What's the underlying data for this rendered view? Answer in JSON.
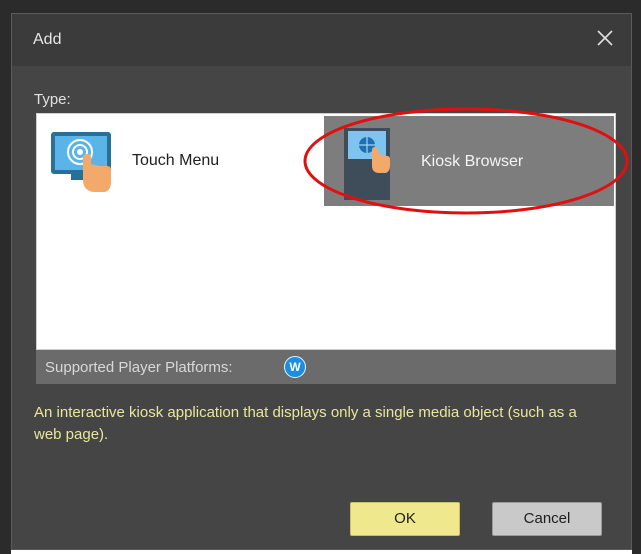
{
  "dialog": {
    "title": "Add",
    "close_icon": "close-icon"
  },
  "type_section": {
    "label": "Type:",
    "items": [
      {
        "label": "Touch Menu",
        "icon": "touch-menu-icon",
        "selected": false
      },
      {
        "label": "Kiosk Browser",
        "icon": "kiosk-browser-icon",
        "selected": true
      }
    ]
  },
  "platforms": {
    "label": "Supported Player Platforms:",
    "badge": "W",
    "badge_color": "#1a8fe0"
  },
  "description": "An interactive kiosk application that displays only a single media object (such as a web page).",
  "buttons": {
    "ok": "OK",
    "cancel": "Cancel"
  },
  "colors": {
    "dialog_bg": "#454545",
    "selection_bg": "#7d7d7d",
    "description_text": "#e8e79a",
    "ok_button": "#f0e88c",
    "annotation_ellipse": "#e01010"
  }
}
